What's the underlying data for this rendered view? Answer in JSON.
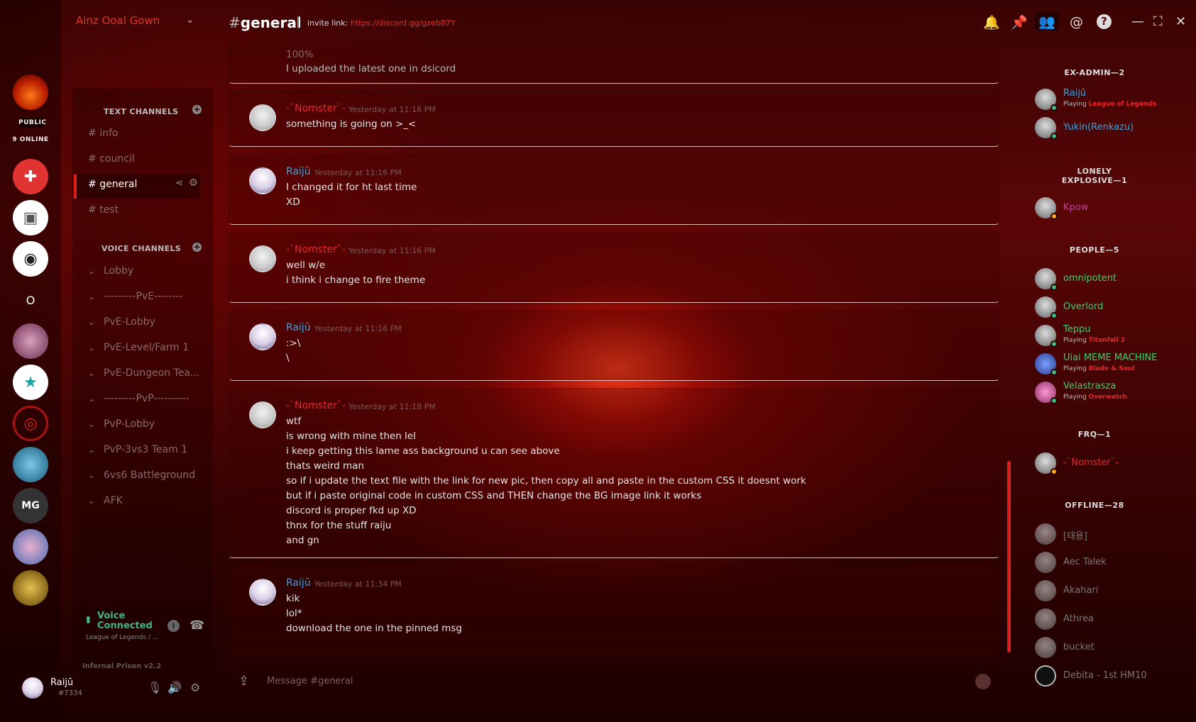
{
  "server": {
    "name": "Ainz Ooal Gown",
    "public_label": "PUBLIC",
    "online_label": "9 ONLINE"
  },
  "channels": {
    "text_header": "TEXT CHANNELS",
    "text": [
      "info",
      "council",
      "general",
      "test"
    ],
    "voice_header": "VOICE CHANNELS",
    "voice": [
      "Lobby",
      "---------PvE--------",
      "PvE-Lobby",
      "PvE-Level/Farm 1",
      "PvE-Dungeon Tea...",
      "---------PvP----------",
      "PvP-Lobby",
      "PvP-3vs3 Team 1",
      "6vs6 Battleground",
      "AFK"
    ]
  },
  "header": {
    "channel": "general",
    "invite_label": "invite link:",
    "invite_url": "https://discord.gg/gzeb87Y"
  },
  "messages": [
    {
      "user": "",
      "time": "",
      "lines": [
        "100%",
        "I uploaded the latest one in dsicord"
      ]
    },
    {
      "user": "-`Nomster`-",
      "time": "Yesterday at 11:16 PM",
      "lines": [
        "something is going on >_<"
      ]
    },
    {
      "user": "Raijū",
      "time": "Yesterday at 11:16 PM",
      "lines": [
        "I changed it for ht last time",
        "XD"
      ]
    },
    {
      "user": "-`Nomster`-",
      "time": "Yesterday at 11:16 PM",
      "lines": [
        "well w/e",
        "i think i change to fire theme"
      ]
    },
    {
      "user": "Raijū",
      "time": "Yesterday at 11:16 PM",
      "lines": [
        ":>\\",
        "\\"
      ]
    },
    {
      "user": "-`Nomster`-",
      "time": "Yesterday at 11:18 PM",
      "lines": [
        "wtf",
        "is wrong with mine then lel",
        "i keep getting this lame ass background u can see above",
        "thats weird man",
        "so if i update the text file with the link for new pic, then copy all and paste in the custom CSS it doesnt work",
        "but if i paste original code in custom CSS and THEN change the BG image link it works",
        "discord is proper fkd up XD",
        "thnx for the stuff raiju",
        "and gn"
      ]
    },
    {
      "user": "Raijū",
      "time": "Yesterday at 11:34 PM",
      "lines": [
        "kik",
        "lol*",
        "download the one in the pinned msg"
      ]
    }
  ],
  "input": {
    "placeholder": "Message #general"
  },
  "voice_status": {
    "title": "Voice Connected",
    "sub": "League of Legends / ..."
  },
  "user": {
    "name": "Raijū",
    "tag": "#7334",
    "theme": "Infernal Prison v2.2"
  },
  "members": {
    "groups": [
      {
        "title": "EX-ADMIN—2",
        "members": [
          {
            "name": "Raijū",
            "playing_label": "Playing",
            "game": "League of Legends"
          },
          {
            "name": "Yukin(Renkazu)"
          }
        ]
      },
      {
        "title": "LONELY EXPLOSIVE—1",
        "members": [
          {
            "name": "Kpow"
          }
        ]
      },
      {
        "title": "PEOPLE—5",
        "members": [
          {
            "name": "omnipotent"
          },
          {
            "name": "Overlord"
          },
          {
            "name": "Teppu",
            "playing_label": "Playing",
            "game": "Titanfall 2"
          },
          {
            "name": "Uiai MEME MACHINE",
            "playing_label": "Playing",
            "game": "Blade & Soul"
          },
          {
            "name": "Velastrasza",
            "playing_label": "Playing",
            "game": "Overwatch"
          }
        ]
      },
      {
        "title": "FRQ—1",
        "members": [
          {
            "name": "-`Nomster`-"
          }
        ]
      },
      {
        "title": "OFFLINE—28",
        "members": [
          {
            "name": "[태용]"
          },
          {
            "name": "Aec Talek"
          },
          {
            "name": "Akahari"
          },
          {
            "name": "Athrea"
          },
          {
            "name": "bucket"
          },
          {
            "name": "Debita - 1st HM10"
          }
        ]
      }
    ]
  },
  "colors": {
    "accent": "#e21b1b",
    "online": "#43b581",
    "idle": "#faa61a",
    "member_people": "#3ccf6a",
    "member_admin": "#3fa0d8"
  },
  "icons": [
    "bell-icon",
    "pin-icon",
    "members-icon",
    "mention-icon",
    "help-icon",
    "minimize-icon",
    "maximize-icon",
    "close-icon",
    "upload-icon",
    "mic-icon",
    "speaker-icon",
    "gear-icon",
    "disconnect-icon",
    "info-icon",
    "share-icon"
  ]
}
